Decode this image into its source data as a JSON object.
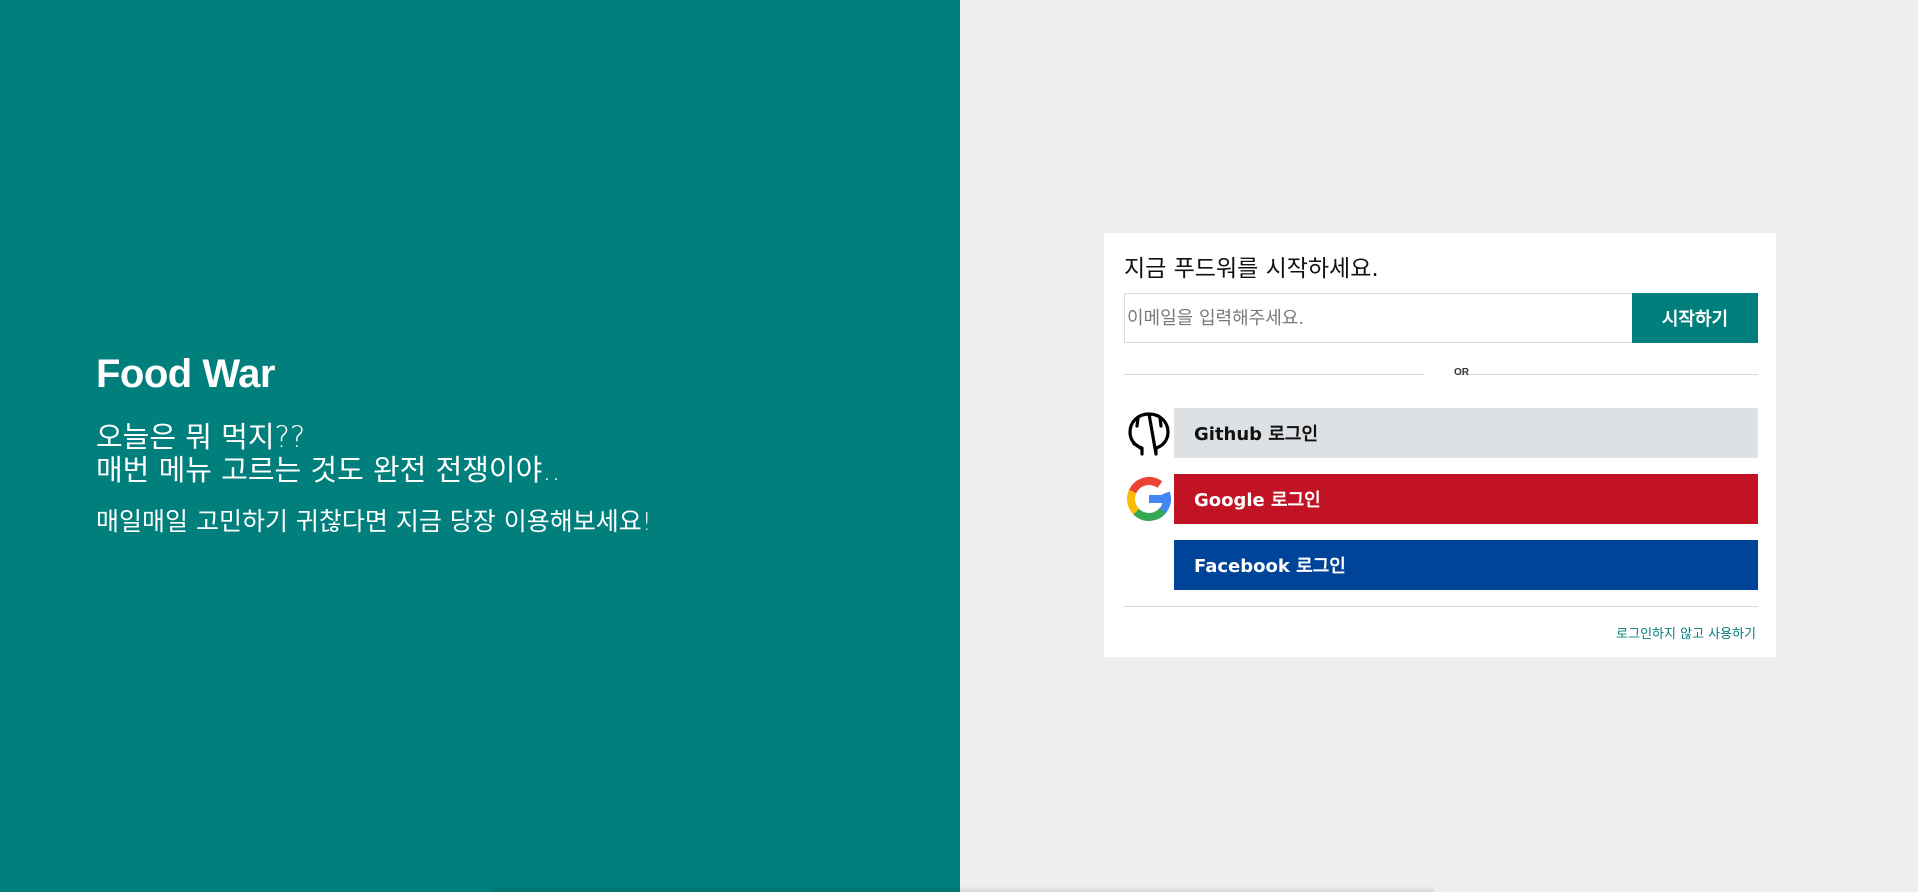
{
  "hero": {
    "brand": "Food War",
    "tagline_line1": "오늘은 뭐 먹지??",
    "tagline_line2": "매번 메뉴 고르는 것도 완전 전쟁이야..",
    "subtitle": "매일매일 고민하기 귀찮다면 지금 당장 이용해보세요!"
  },
  "login": {
    "title": "지금 푸드워를 시작하세요.",
    "email_placeholder": "이메일을 입력해주세요.",
    "email_value": "",
    "start_label": "시작하기",
    "or_label": "OR",
    "github_label": "Github 로그인",
    "google_label": "Google 로그인",
    "facebook_label": "Facebook 로그인",
    "guest_label": "로그인하지 않고 사용하기"
  },
  "colors": {
    "teal": "#017f7c",
    "github": "#dee1e4",
    "google": "#c21324",
    "facebook": "#004499"
  },
  "icons": {
    "github": "github-octocat-icon",
    "google": "google-g-icon"
  }
}
